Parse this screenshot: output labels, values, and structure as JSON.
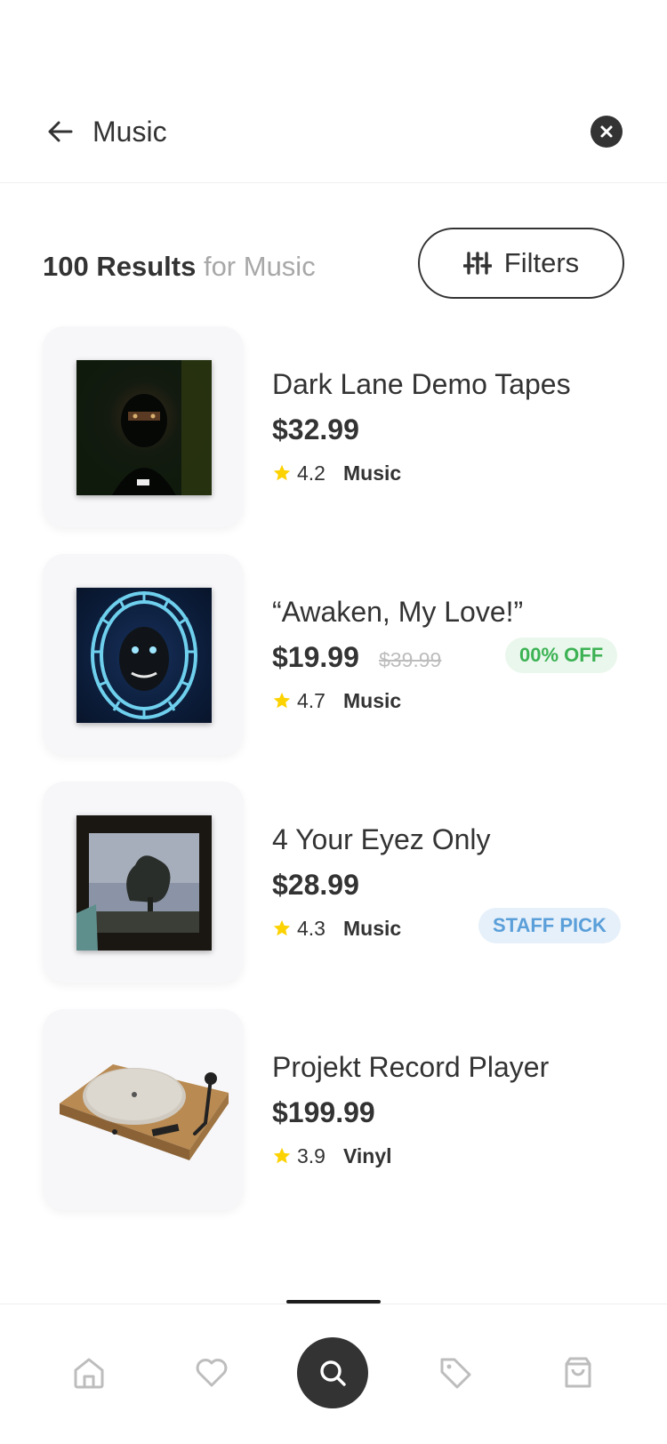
{
  "search": {
    "query": "Music"
  },
  "results": {
    "count_label": "100 Results",
    "for_label": "for Music",
    "filters_label": "Filters"
  },
  "products": [
    {
      "title": "Dark Lane Demo Tapes",
      "price": "$32.99",
      "rating": "4.2",
      "category": "Music",
      "image": "album-cover-dark-lane-demo-tapes"
    },
    {
      "title": "“Awaken, My Love!”",
      "price": "$19.99",
      "old_price": "$39.99",
      "badge": "00% OFF",
      "rating": "4.7",
      "category": "Music",
      "image": "album-cover-awaken-my-love"
    },
    {
      "title": "4 Your Eyez Only",
      "price": "$28.99",
      "badge": "STAFF PICK",
      "rating": "4.3",
      "category": "Music",
      "image": "album-cover-4-your-eyez-only"
    },
    {
      "title": "Projekt Record Player",
      "price": "$199.99",
      "rating": "3.9",
      "category": "Vinyl",
      "image": "record-player-photo"
    }
  ],
  "nav": {
    "items": [
      "home-icon",
      "heart-icon",
      "search-icon",
      "tag-icon",
      "shopping-bag-icon"
    ],
    "active": "search-icon"
  },
  "colors": {
    "text": "#333333",
    "muted": "#a8a8a8",
    "star": "#fcd200",
    "sale_green": "#3cb254",
    "sale_bg": "#eaf7ec",
    "staff_blue": "#5a9fd9",
    "staff_bg": "#e6f0fa",
    "card_bg": "#f7f7f9"
  }
}
